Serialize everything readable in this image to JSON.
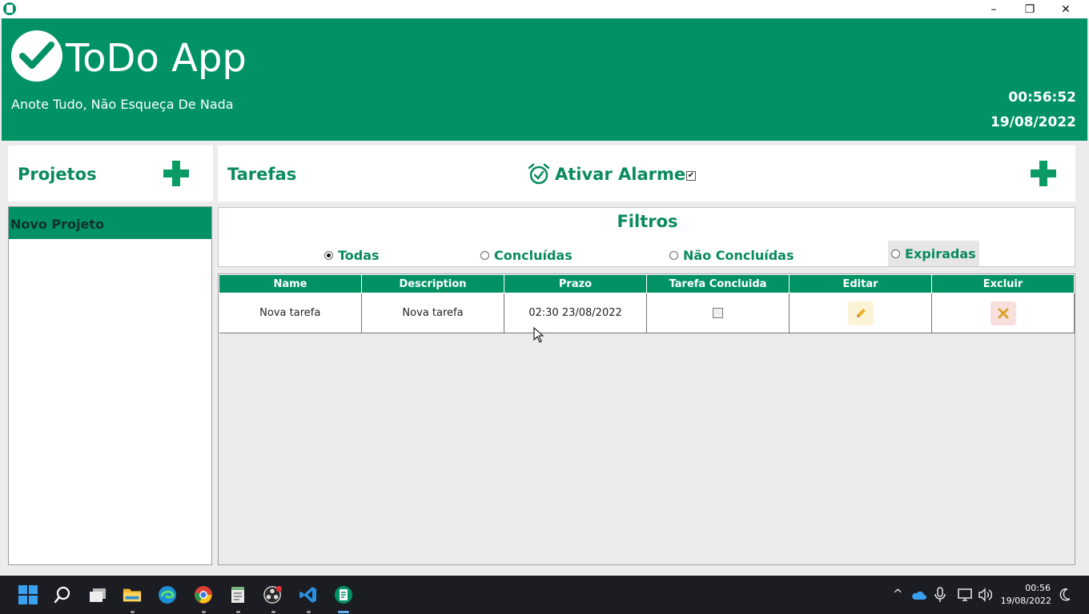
{
  "window": {
    "controls": {
      "minimize": "–",
      "maximize": "❐",
      "close": "✕"
    }
  },
  "header": {
    "title": "ToDo App",
    "subtitle": "Anote Tudo, Não Esqueça De Nada",
    "time": "00:56:52",
    "date": "19/08/2022"
  },
  "projects": {
    "title": "Projetos",
    "items": [
      {
        "label": "Novo Projeto",
        "selected": true
      }
    ]
  },
  "tasks": {
    "title": "Tarefas",
    "alarm_label": "Ativar Alarme",
    "alarm_checked": true,
    "alarm_check_glyph": "✔"
  },
  "filters": {
    "title": "Filtros",
    "options": [
      {
        "label": "Todas",
        "selected": true
      },
      {
        "label": "Concluídas",
        "selected": false
      },
      {
        "label": "Não Concluídas",
        "selected": false
      },
      {
        "label": "Expiradas",
        "selected": false
      }
    ]
  },
  "table": {
    "columns": [
      "Name",
      "Description",
      "Prazo",
      "Tarefa Concluida",
      "Editar",
      "Excluir"
    ],
    "rows": [
      {
        "name": "Nova tarefa",
        "description": "Nova tarefa",
        "prazo": "02:30 23/08/2022",
        "concluida": false
      }
    ]
  },
  "taskbar": {
    "clock_time": "00:56",
    "clock_date": "19/08/2022",
    "apps": [
      "start-icon",
      "search-icon",
      "task-view-icon",
      "file-explorer-icon",
      "edge-icon",
      "chrome-icon",
      "notepad-icon",
      "obs-icon",
      "vscode-icon",
      "todo-app-icon"
    ]
  },
  "colors": {
    "brand_green": "#009264",
    "text_green": "#0a8a5e",
    "taskbar": "#1b1d23"
  }
}
